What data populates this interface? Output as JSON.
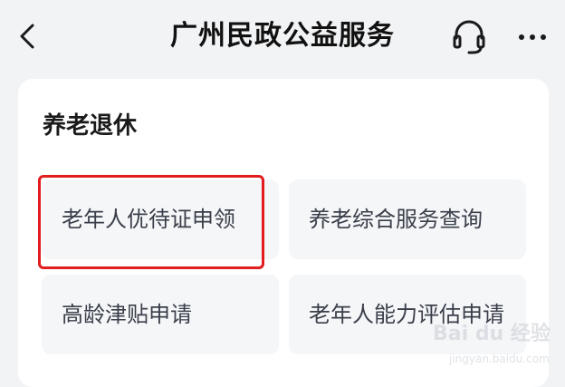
{
  "header": {
    "title": "广州民政公益服务",
    "back_icon": "chevron-left-icon",
    "support_icon": "headset-icon",
    "more_icon": "more-horizontal-icon"
  },
  "section": {
    "title": "养老退休",
    "items": [
      {
        "label": "老年人优待证申领",
        "highlighted": true
      },
      {
        "label": "养老综合服务查询"
      },
      {
        "label": "高龄津贴申请"
      },
      {
        "label": "老年人能力评估申请"
      }
    ]
  },
  "watermark": {
    "main": "Bai du 经验",
    "sub": "jingyan.baidu.com"
  },
  "colors": {
    "background": "#f2f3f5",
    "card": "#ffffff",
    "tile": "#f5f6f8",
    "highlight": "#e11d1d"
  }
}
